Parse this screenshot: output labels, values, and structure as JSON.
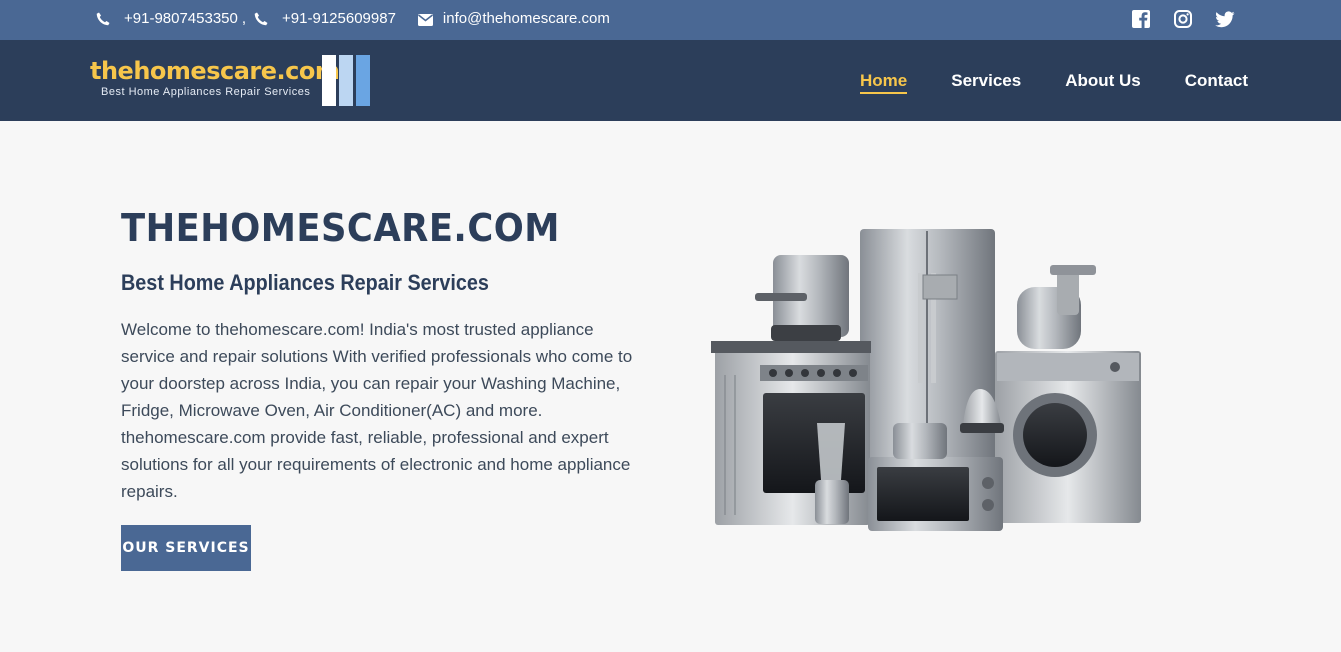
{
  "topbar": {
    "phone1": "+91-9807453350",
    "separator": ",",
    "phone2": "+91-9125609987",
    "email": "info@thehomescare.com",
    "icons": [
      "phone-icon",
      "phone-icon",
      "mail-icon",
      "facebook-icon",
      "instagram-icon",
      "twitter-icon"
    ]
  },
  "brand": {
    "name": "thehomescare.com",
    "tagline": "Best Home Appliances Repair Services",
    "logo_colors": [
      "#ffffff",
      "#bcd6f2",
      "#6aa5e3"
    ]
  },
  "nav": {
    "items": [
      {
        "label": "Home",
        "active": true
      },
      {
        "label": "Services",
        "active": false
      },
      {
        "label": "About Us",
        "active": false
      },
      {
        "label": "Contact",
        "active": false
      }
    ]
  },
  "hero": {
    "title": "THEHOMESCARE.COM",
    "subtitle": "Best Home Appliances Repair Services",
    "body": "Welcome to thehomescare.com! India's most trusted appliance service and repair solutions With verified professionals who come to your doorstep across India, you can repair your Washing Machine, Fridge, Microwave Oven, Air Conditioner(AC) and more. thehomescare.com provide fast, reliable, professional and expert solutions for all your requirements of electronic and home appliance repairs.",
    "cta_label": "OUR SERVICES"
  },
  "colors": {
    "topbar": "#4a6894",
    "navbar": "#2c3e5a",
    "accent": "#f7c64b",
    "button": "#4a6894"
  }
}
